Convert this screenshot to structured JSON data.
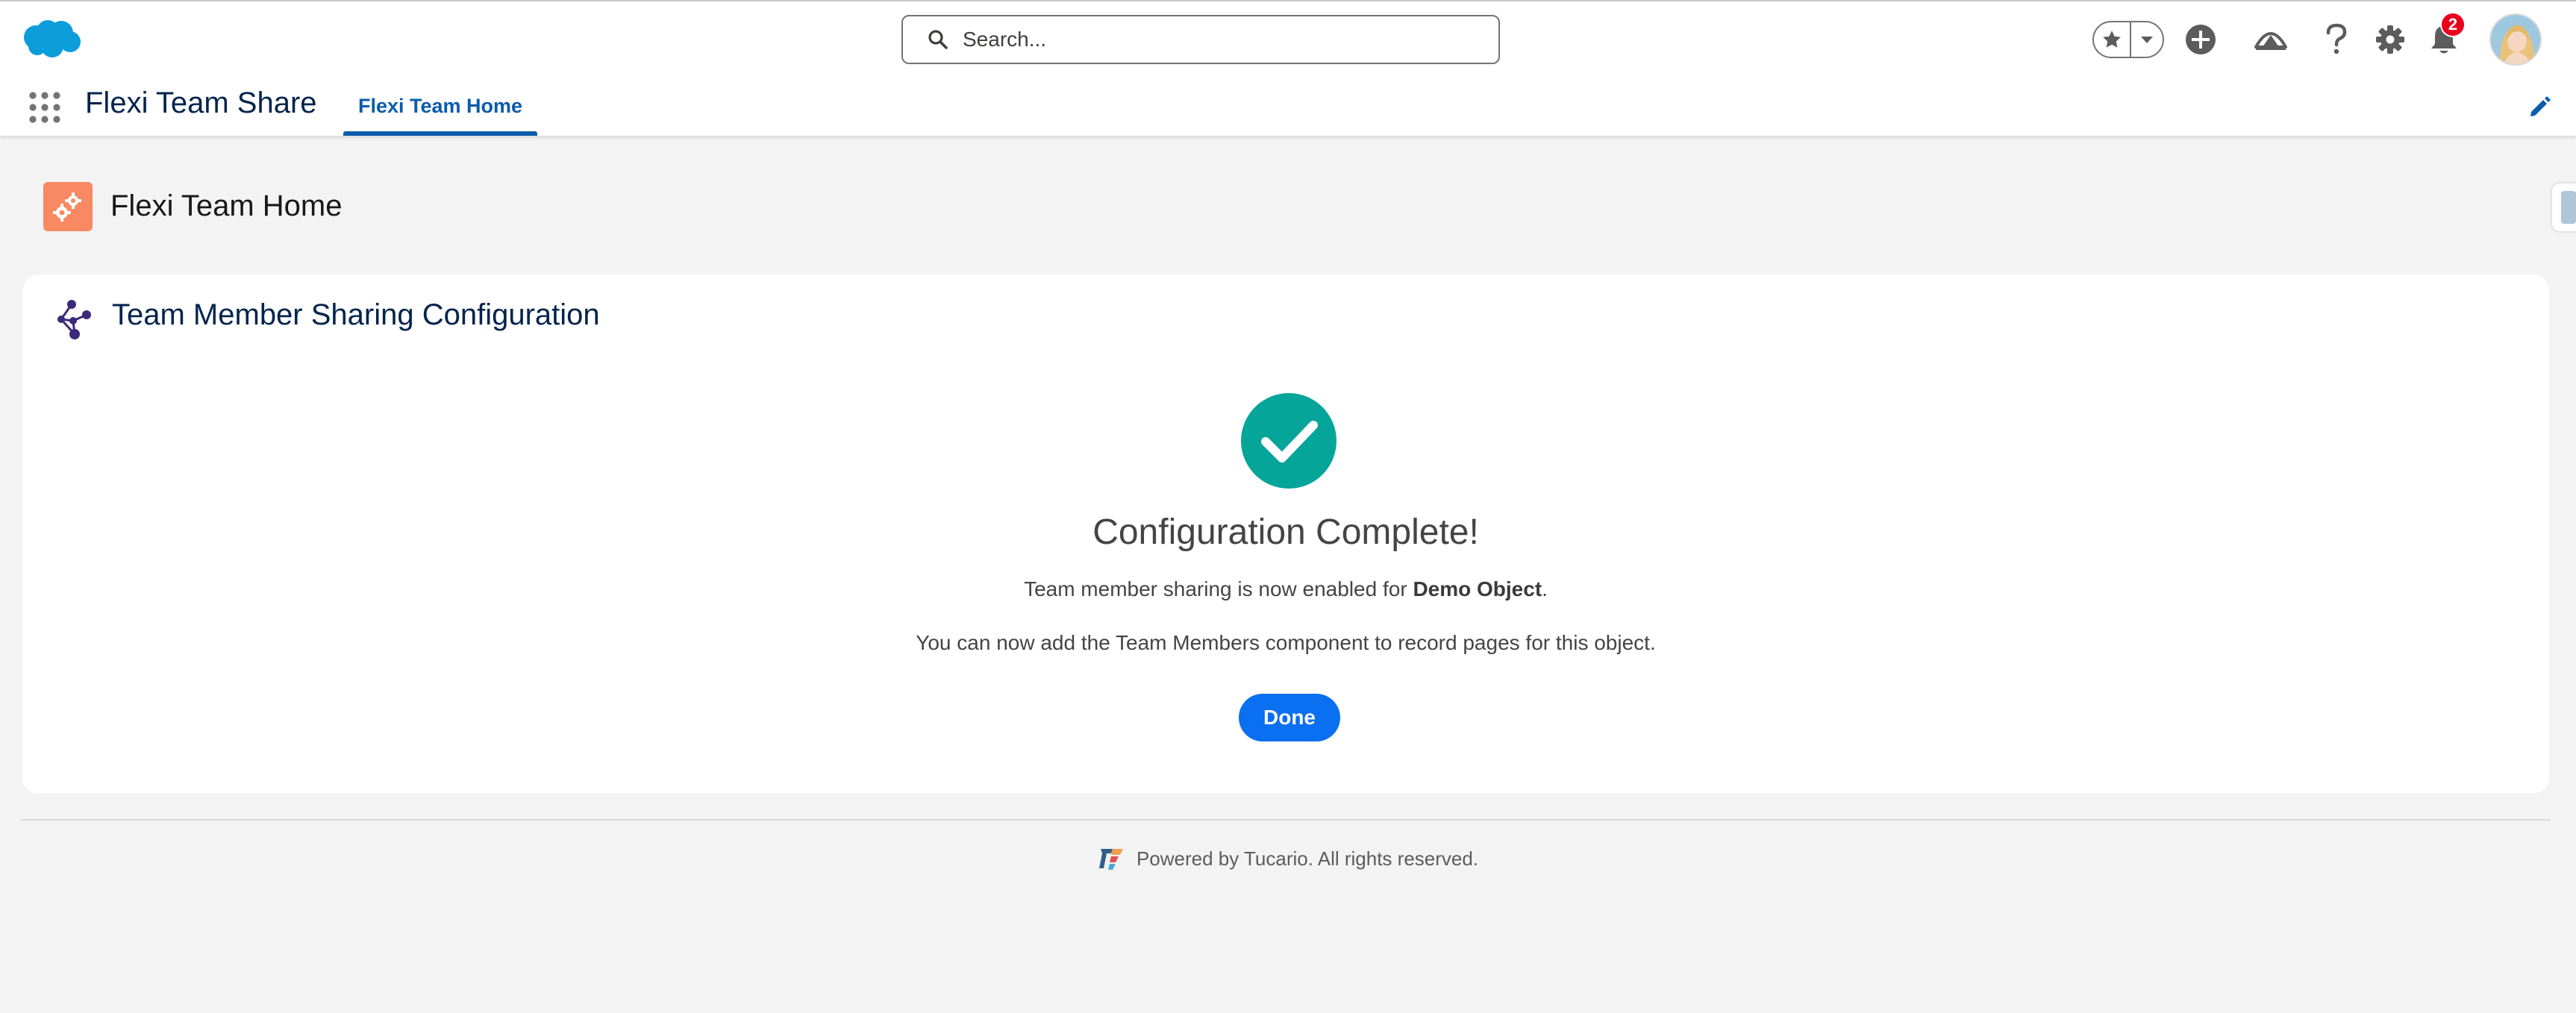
{
  "header": {
    "search_placeholder": "Search...",
    "notification_count": "2"
  },
  "app": {
    "name": "Flexi Team Share",
    "active_tab": "Flexi Team Home"
  },
  "page": {
    "title": "Flexi Team Home"
  },
  "card": {
    "title": "Team Member Sharing Configuration",
    "heading": "Configuration Complete!",
    "message_prefix": "Team member sharing is now enabled for ",
    "object_name": "Demo Object",
    "message_suffix": ".",
    "message2": "You can now add the Team Members component to record pages for this object.",
    "done_label": "Done"
  },
  "footer": {
    "text": "Powered by Tucario. All rights reserved."
  },
  "colors": {
    "brand_blue": "#0b5cab",
    "button_blue": "#0b6ff2",
    "success_teal": "#06a59a",
    "page_icon_bg": "#f88962",
    "badge_red": "#ea001e"
  },
  "icons": {
    "logo": "salesforce-cloud-logo",
    "search": "search-icon",
    "favorites": "star-icon",
    "global_actions": "plus-circle-icon",
    "trailhead": "trailhead-icon",
    "help": "question-icon",
    "setup": "gear-icon",
    "notifications": "bell-icon",
    "app_launcher": "waffle-icon",
    "edit_nav": "pencil-icon",
    "page": "gears-icon",
    "card": "network-icon",
    "success": "checkmark-circle-icon"
  }
}
